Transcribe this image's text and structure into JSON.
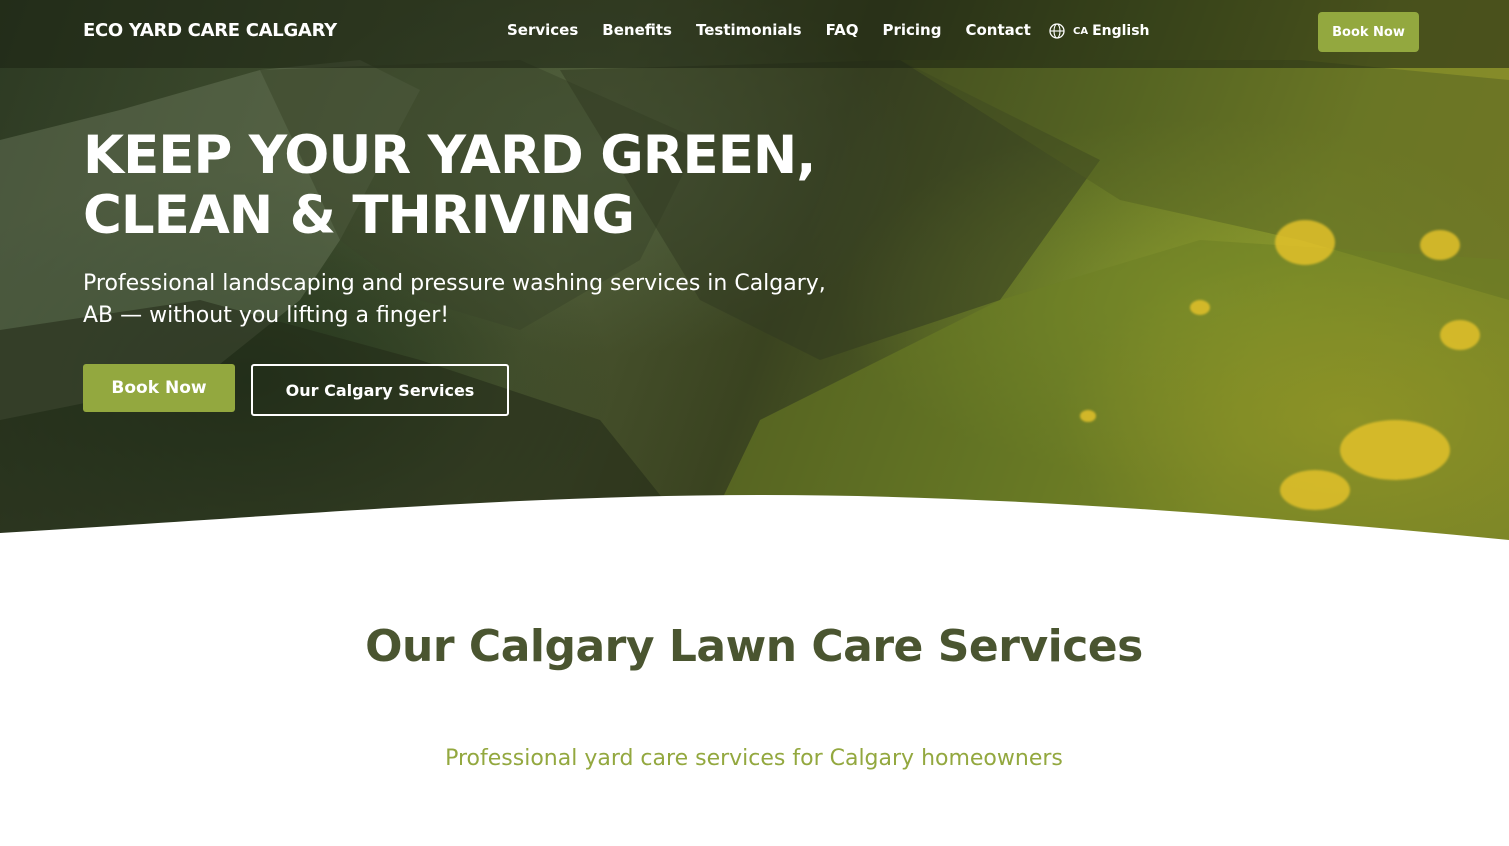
{
  "nav": {
    "brand": "ECO YARD CARE CALGARY",
    "links": [
      "Services",
      "Benefits",
      "Testimonials",
      "FAQ",
      "Pricing",
      "Contact"
    ],
    "language": {
      "flag": "CA",
      "label": "English",
      "icon": "globe-icon"
    },
    "book_label": "Book Now"
  },
  "hero": {
    "title_line1": "KEEP YOUR YARD GREEN,",
    "title_line2": "CLEAN & THRIVING",
    "subtitle": "Professional landscaping and pressure washing services in Calgary, AB — without you lifting a finger!",
    "primary_cta": "Book Now",
    "secondary_cta": "Our Calgary Services"
  },
  "services": {
    "title": "Our Calgary Lawn Care Services",
    "subtitle": "Professional yard care services for Calgary homeowners"
  },
  "colors": {
    "accent": "#93a83f",
    "heading": "#4a5530",
    "nav_overlay": "#1c2212"
  }
}
